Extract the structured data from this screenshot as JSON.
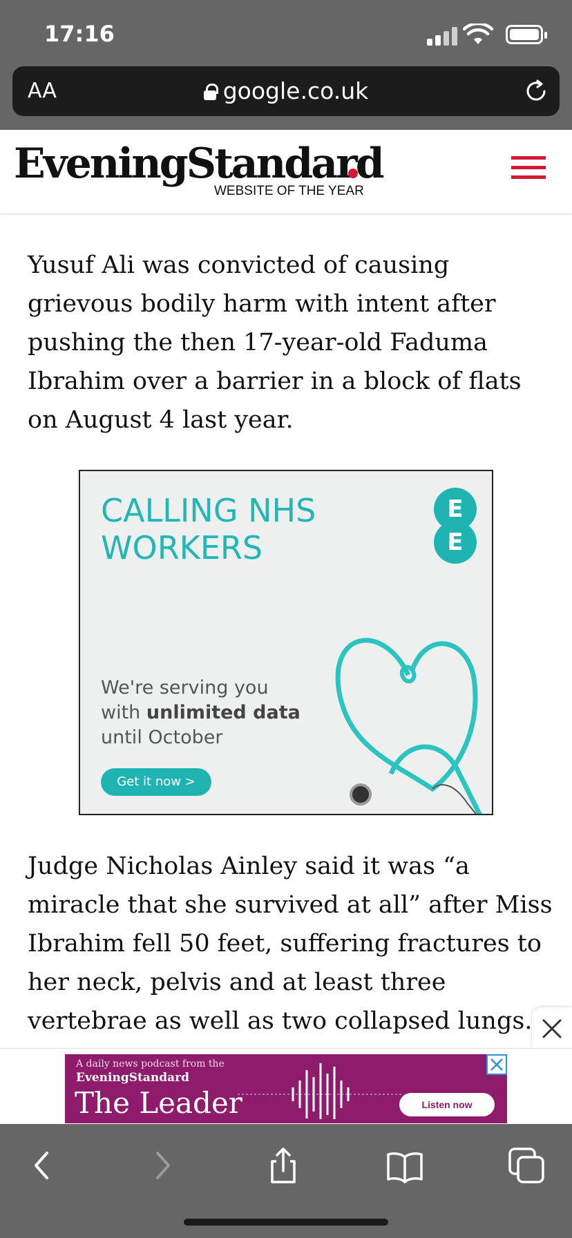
{
  "status_bar": {
    "time": "17:16"
  },
  "browser": {
    "aa_label": "AA",
    "url": "google.co.uk"
  },
  "site": {
    "logo": "EveningStandard",
    "tagline": "WEBSITE OF THE YEAR"
  },
  "article": {
    "paragraph_1": "Yusuf Ali was convicted of causing grievous bodily harm with intent after pushing the then 17-year-old Faduma Ibrahim over a barrier in a block of flats on August 4 last year.",
    "paragraph_2": "Judge Nicholas Ainley said it was “a miracle that she survived at all” after Miss Ibrahim fell 50 feet, suffering fractures to her neck, pelvis and at least three vertebrae as well as two collapsed lungs."
  },
  "ad": {
    "title_line_1": "CALLING NHS",
    "title_line_2": "WORKERS",
    "logo_letter_1": "E",
    "logo_letter_2": "E",
    "copy_line_1": "We're serving you",
    "copy_line_2_prefix": "with ",
    "copy_line_2_bold": "unlimited data",
    "copy_line_3": "until October",
    "cta": "Get it now >",
    "accent_color": "#1fb3b1"
  },
  "podcast_banner": {
    "small_text": "A daily news podcast from the",
    "brand": "EveningStandard",
    "title": "The Leader",
    "button": "Listen now",
    "background_color": "#8f1b6c"
  },
  "colors": {
    "brand_red": "#d31a35",
    "chrome_gray": "#666666"
  }
}
